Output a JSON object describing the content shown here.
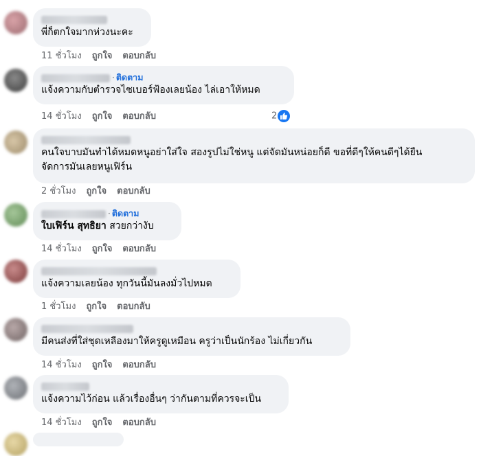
{
  "comments": [
    {
      "name": "",
      "follow": "",
      "text": "พี่ก็ตกใจมากห่วงนะคะ",
      "time": "11 ชั่วโมง",
      "like": "ถูกใจ",
      "reply": "ตอบกลับ",
      "reactions": ""
    },
    {
      "name": "",
      "follow": "ติดตาม",
      "text": "แจ้งความกับตำรวจไซเบอร์ฟ้องเลยน้อง ไล่เอาให้หมด",
      "time": "14 ชั่วโมง",
      "like": "ถูกใจ",
      "reply": "ตอบกลับ",
      "reactions": "2"
    },
    {
      "name": "",
      "follow": "",
      "text_line1": "คนใจบาบมันทำได้หมดหนูอย่าใส่ใจ สองรูปไม่ใช่หนู แต่จัดมันหน่อยก็ดี ขอที่ดีๆให้คนดีๆได้ยืน",
      "text_line2": "จัดการมันเลยหนูเฟิร์น",
      "time": "2 ชั่วโมง",
      "like": "ถูกใจ",
      "reply": "ตอบกลับ"
    },
    {
      "name": "",
      "follow": "ติดตาม",
      "mention": "ใบเฟิร์น สุทธิยา",
      "text": "สวยกว่างับ",
      "time": "14 ชั่วโมง",
      "like": "ถูกใจ",
      "reply": "ตอบกลับ"
    },
    {
      "name": "",
      "follow": "",
      "text": "แจ้งความเลยน้อง ทุกวันนี้มันลงมั่วไปหมด",
      "time": "1 ชั่วโมง",
      "like": "ถูกใจ",
      "reply": "ตอบกลับ"
    },
    {
      "name": "",
      "follow": "",
      "text": "มีคนส่งที่ใส่ชุดเหลืองมาให้ครูดูเหมือน ครูว่าเป็นนักร้อง ไม่เกี่ยวกัน",
      "time": "14 ชั่วโมง",
      "like": "ถูกใจ",
      "reply": "ตอบกลับ"
    },
    {
      "name": "",
      "follow": "",
      "text": "แจ้งความไว้ก่อน แล้วเรื่องอื่นๆ ว่ากันตามที่ควรจะเป็น",
      "time": "14 ชั่วโมง",
      "like": "ถูกใจ",
      "reply": "ตอบกลับ"
    }
  ],
  "colors": {
    "bubble": "#f0f2f5",
    "follow": "#216fdb",
    "meta": "#65676b",
    "like": "#1877f2"
  }
}
